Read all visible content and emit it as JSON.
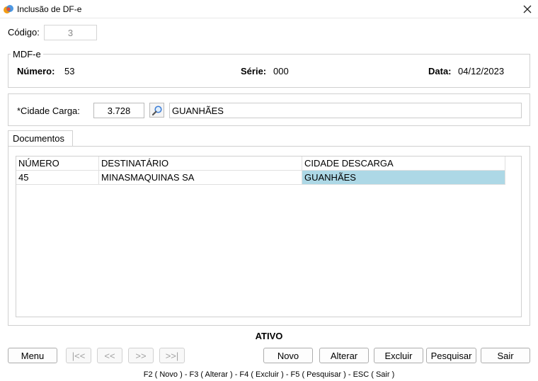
{
  "window": {
    "title": "Inclusão de DF-e"
  },
  "codigo": {
    "label": "Código:",
    "value": "3"
  },
  "mdfe": {
    "legend": "MDF-e",
    "numero_label": "Número:",
    "numero_value": "53",
    "serie_label": "Série:",
    "serie_value": "000",
    "data_label": "Data:",
    "data_value": "04/12/2023"
  },
  "carga": {
    "label": "*Cidade Carga:",
    "code": "3.728",
    "city": "GUANHÃES"
  },
  "tabs": [
    {
      "label": "Documentos"
    }
  ],
  "grid": {
    "columns": [
      "NÚMERO",
      "DESTINATÁRIO",
      "CIDADE DESCARGA"
    ],
    "rows": [
      [
        "45",
        "MINASMAQUINAS SA",
        "GUANHÃES"
      ]
    ]
  },
  "status": "ATIVO",
  "buttons": {
    "menu": "Menu",
    "first": "|<<",
    "prev": "<<",
    "next": ">>",
    "last": ">>|",
    "novo": "Novo",
    "alterar": "Alterar",
    "excluir": "Excluir",
    "pesquisar": "Pesquisar",
    "sair": "Sair"
  },
  "hint": "F2 ( Novo )  -  F3 ( Alterar )  -  F4 ( Excluir )  -  F5 ( Pesquisar )  -  ESC ( Sair )",
  "colors": {
    "selection": "#add8e6"
  },
  "icons": {
    "app": "app-logo-icon",
    "close": "close-icon",
    "search": "magnifier-icon"
  }
}
